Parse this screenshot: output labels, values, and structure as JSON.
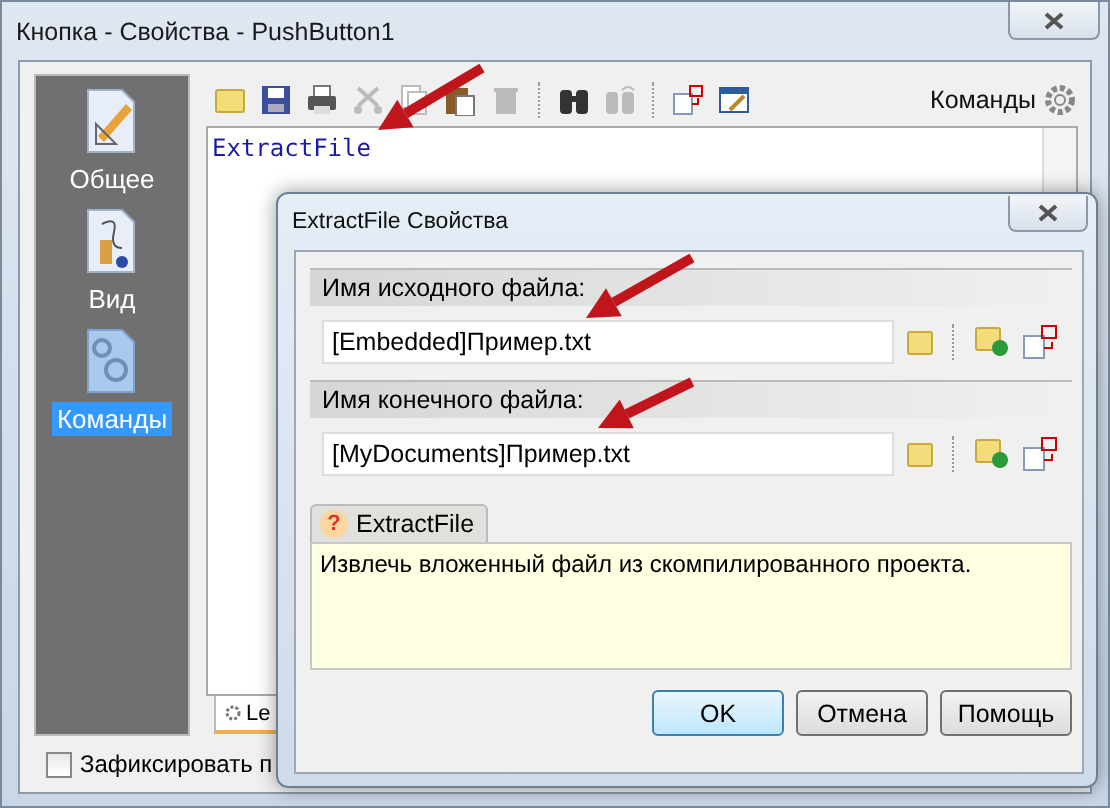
{
  "window": {
    "title": "Кнопка - Свойства - PushButton1"
  },
  "sidebar": {
    "items": [
      {
        "label": "Общее",
        "kind": "general",
        "selected": false
      },
      {
        "label": "Вид",
        "kind": "view",
        "selected": false
      },
      {
        "label": "Команды",
        "kind": "commands",
        "selected": true
      }
    ]
  },
  "toolbar": {
    "buttons": [
      {
        "kind": "folder",
        "disabled": false
      },
      {
        "kind": "save",
        "disabled": false
      },
      {
        "kind": "print",
        "disabled": false
      },
      {
        "kind": "cut",
        "disabled": true
      },
      {
        "kind": "copy",
        "disabled": true
      },
      {
        "kind": "paste",
        "disabled": false
      },
      {
        "kind": "delete",
        "disabled": true
      },
      {
        "kind": "find",
        "disabled": false
      },
      {
        "kind": "replace",
        "disabled": true
      },
      {
        "kind": "insert",
        "disabled": false
      },
      {
        "kind": "edit",
        "disabled": false
      }
    ],
    "label": "Команды"
  },
  "editor": {
    "code": "ExtractFile"
  },
  "tabs": [
    {
      "label": "Le",
      "selected": true
    }
  ],
  "lock_checkbox": {
    "label": "Зафиксировать п",
    "checked": false
  },
  "dialog": {
    "title": "ExtractFile Свойства",
    "fields": [
      {
        "label": "Имя исходного файла:",
        "value": "[Embedded]Пример.txt"
      },
      {
        "label": "Имя конечного файла:",
        "value": "[MyDocuments]Пример.txt"
      }
    ],
    "help": {
      "icon": "?",
      "title": "ExtractFile",
      "text": "Извлечь вложенный файл из скомпилированного проекта."
    },
    "buttons": [
      {
        "label": "OK",
        "default": true
      },
      {
        "label": "Отмена",
        "default": false
      },
      {
        "label": "Помощь",
        "default": false
      }
    ]
  }
}
